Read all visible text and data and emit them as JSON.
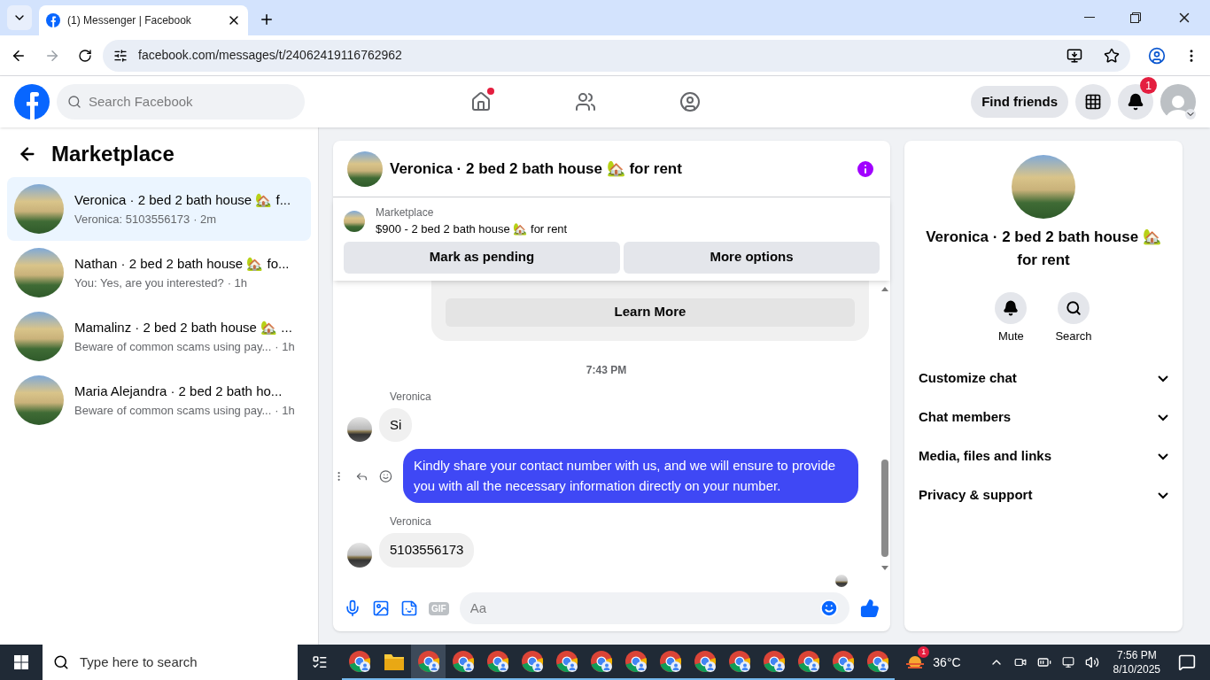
{
  "browser": {
    "tab": {
      "title": "(1) Messenger | Facebook",
      "selected": true
    },
    "url": "facebook.com/messages/t/24062419116762962"
  },
  "header": {
    "search_placeholder": "Search Facebook",
    "nav": [
      {
        "kind": "home",
        "selected": false,
        "dot": true
      },
      {
        "kind": "friends",
        "selected": false,
        "dot": false
      },
      {
        "kind": "groups",
        "selected": false,
        "dot": false
      }
    ],
    "find_friends": "Find friends",
    "notification_count": "1"
  },
  "sidebar": {
    "title": "Marketplace",
    "conversations": [
      {
        "title": "Veronica · 2 bed 2 bath house 🏡 f...",
        "preview": "Veronica: 5103556173",
        "time": "· 2m",
        "selected": true
      },
      {
        "title": "Nathan · 2 bed 2 bath house 🏡 fo...",
        "preview": "You: Yes, are you interested?",
        "time": "· 1h",
        "selected": false
      },
      {
        "title": "Mamalinz · 2 bed 2 bath house 🏡 ...",
        "preview": "Beware of common scams using pay...",
        "time": "· 1h",
        "selected": false
      },
      {
        "title": "Maria Alejandra · 2 bed 2 bath ho...",
        "preview": "Beware of common scams using pay...",
        "time": "· 1h",
        "selected": false
      }
    ]
  },
  "chat": {
    "title": "Veronica · 2 bed 2 bath house 🏡 for rent",
    "listing": {
      "source": "Marketplace",
      "title": "$900 - 2 bed 2 bath house 🏡 for rent"
    },
    "actions": [
      "Mark as pending",
      "More options"
    ],
    "learn_more": "Learn More",
    "timestamp": "7:43 PM",
    "messages": [
      {
        "kind": "incoming",
        "sender": "Veronica",
        "text": "Si"
      },
      {
        "kind": "outgoing",
        "text": "Kindly share your contact number with us, and we will ensure to provide you with all the necessary information directly on your number."
      },
      {
        "kind": "incoming",
        "sender": "Veronica",
        "text": "5103556173"
      }
    ],
    "composer": {
      "placeholder": "Aa",
      "gif_label": "GIF"
    }
  },
  "details": {
    "title": "Veronica · 2 bed 2 bath house 🏡 for rent",
    "actions": [
      {
        "kind": "mute",
        "label": "Mute"
      },
      {
        "kind": "search",
        "label": "Search"
      }
    ],
    "sections": [
      {
        "label": "Customize chat",
        "expanded": false
      },
      {
        "label": "Chat members",
        "expanded": false
      },
      {
        "label": "Media, files and links",
        "expanded": false
      },
      {
        "label": "Privacy & support",
        "expanded": false
      }
    ]
  },
  "taskbar": {
    "search_placeholder": "Type here to search",
    "apps": [
      {
        "kind": "chrome",
        "selected": false
      },
      {
        "kind": "folder",
        "selected": false
      },
      {
        "kind": "chrome",
        "selected": true
      },
      {
        "kind": "chrome",
        "selected": false
      },
      {
        "kind": "chrome",
        "selected": false
      },
      {
        "kind": "chrome",
        "selected": false
      },
      {
        "kind": "chrome",
        "selected": false
      },
      {
        "kind": "chrome",
        "selected": false
      },
      {
        "kind": "chrome",
        "selected": false
      },
      {
        "kind": "chrome",
        "selected": false
      },
      {
        "kind": "chrome",
        "selected": false
      },
      {
        "kind": "chrome",
        "selected": false
      },
      {
        "kind": "chrome",
        "selected": false
      },
      {
        "kind": "chrome",
        "selected": false
      },
      {
        "kind": "chrome",
        "selected": false
      },
      {
        "kind": "chrome",
        "selected": false
      }
    ],
    "weather_badge": "1",
    "temperature": "36°C",
    "time": "7:56 PM",
    "date": "8/10/2025"
  }
}
